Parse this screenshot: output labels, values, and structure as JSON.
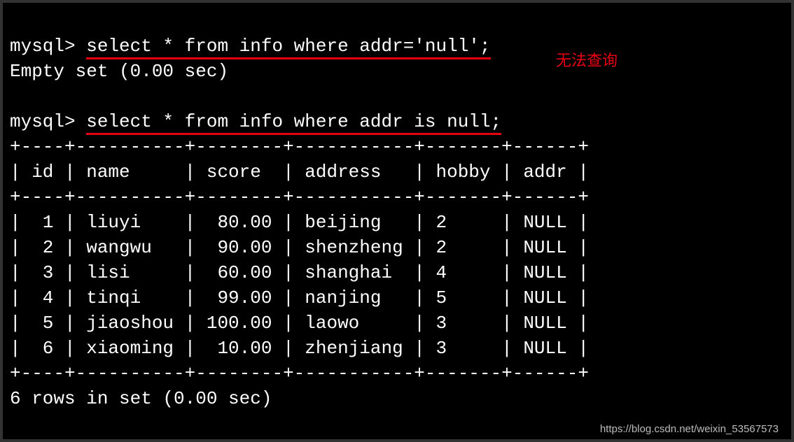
{
  "prompt": "mysql> ",
  "query1": {
    "sql": "select * from info where addr='null';",
    "result": "Empty set (0.00 sec)"
  },
  "annotation1": "无法查询",
  "query2": {
    "sql": "select * from info where addr is null;"
  },
  "border_line": "+----+----------+--------+-----------+-------+------+",
  "header_line": "| id | name     | score  | address   | hobby | addr |",
  "rows_rendered": [
    "|  1 | liuyi    |  80.00 | beijing   | 2     | NULL |",
    "|  2 | wangwu   |  90.00 | shenzheng | 2     | NULL |",
    "|  3 | lisi     |  60.00 | shanghai  | 4     | NULL |",
    "|  4 | tinqi    |  99.00 | nanjing   | 5     | NULL |",
    "|  5 | jiaoshou | 100.00 | laowo     | 3     | NULL |",
    "|  6 | xiaoming |  10.00 | zhenjiang | 3     | NULL |"
  ],
  "footer": "6 rows in set (0.00 sec)",
  "watermark": "https://blog.csdn.net/weixin_53567573",
  "chart_data": {
    "type": "table",
    "columns": [
      "id",
      "name",
      "score",
      "address",
      "hobby",
      "addr"
    ],
    "rows": [
      {
        "id": 1,
        "name": "liuyi",
        "score": 80.0,
        "address": "beijing",
        "hobby": 2,
        "addr": null
      },
      {
        "id": 2,
        "name": "wangwu",
        "score": 90.0,
        "address": "shenzheng",
        "hobby": 2,
        "addr": null
      },
      {
        "id": 3,
        "name": "lisi",
        "score": 60.0,
        "address": "shanghai",
        "hobby": 4,
        "addr": null
      },
      {
        "id": 4,
        "name": "tinqi",
        "score": 99.0,
        "address": "nanjing",
        "hobby": 5,
        "addr": null
      },
      {
        "id": 5,
        "name": "jiaoshou",
        "score": 100.0,
        "address": "laowo",
        "hobby": 3,
        "addr": null
      },
      {
        "id": 6,
        "name": "xiaoming",
        "score": 10.0,
        "address": "zhenjiang",
        "hobby": 3,
        "addr": null
      }
    ],
    "row_count": 6,
    "elapsed_sec": 0.0
  }
}
